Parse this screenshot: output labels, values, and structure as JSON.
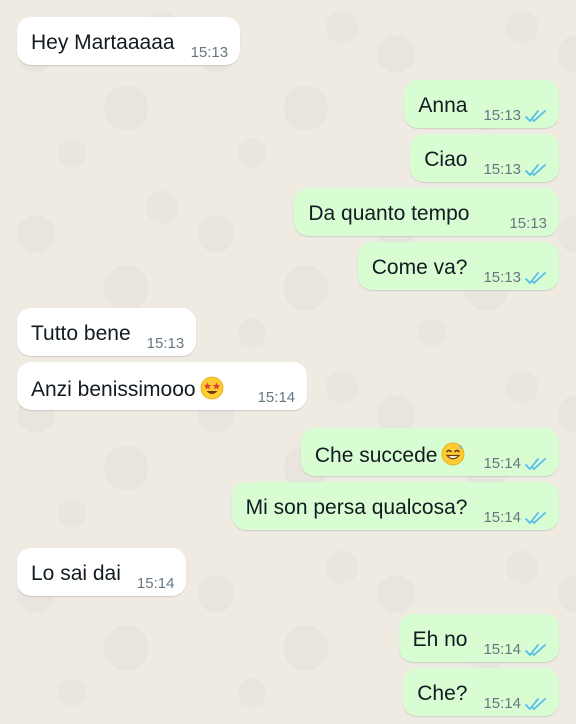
{
  "colors": {
    "background": "#efeae2",
    "incoming_bubble": "#ffffff",
    "outgoing_bubble": "#d9fdd3",
    "read_ticks": "#53bdeb",
    "timestamp": "#667781"
  },
  "messages": [
    {
      "direction": "in",
      "text": "Hey Martaaaaa",
      "time": "15:13"
    },
    {
      "direction": "out",
      "text": "Anna",
      "time": "15:13",
      "status": "read"
    },
    {
      "direction": "out",
      "text": "Ciao",
      "time": "15:13",
      "status": "read"
    },
    {
      "direction": "out",
      "text": "Da quanto tempo",
      "time": "15:13",
      "status": "none"
    },
    {
      "direction": "out",
      "text": "Come va?",
      "time": "15:13",
      "status": "read"
    },
    {
      "direction": "in",
      "text": "Tutto bene",
      "time": "15:13"
    },
    {
      "direction": "in",
      "text": "Anzi benissimooo",
      "time": "15:14",
      "emoji": "star-struck-emoji"
    },
    {
      "direction": "out",
      "text": "Che succede",
      "time": "15:14",
      "status": "read",
      "emoji": "grinning-sweat-emoji"
    },
    {
      "direction": "out",
      "text": "Mi son persa qualcosa?",
      "time": "15:14",
      "status": "read"
    },
    {
      "direction": "in",
      "text": "Lo sai dai",
      "time": "15:14"
    },
    {
      "direction": "out",
      "text": "Eh no",
      "time": "15:14",
      "status": "read"
    },
    {
      "direction": "out",
      "text": "Che?",
      "time": "15:14",
      "status": "read"
    }
  ]
}
